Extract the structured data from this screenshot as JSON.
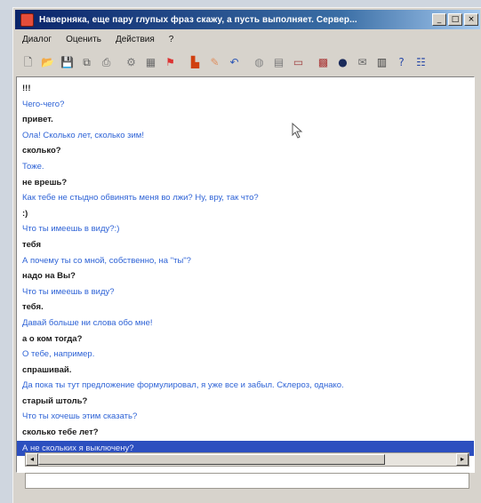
{
  "window": {
    "title": "Наверняка, еще пару глупых фраз скажу, а пусть выполняет. Сервер...",
    "controls": {
      "minimize": "_",
      "maximize": "□",
      "close": "×"
    }
  },
  "menu": [
    "Диалог",
    "Оценить",
    "Действия",
    "?"
  ],
  "toolbar": {
    "icons": [
      {
        "name": "new-doc-icon",
        "glyph": "🗋",
        "color": "#555555"
      },
      {
        "name": "open-folder-icon",
        "glyph": "📂",
        "color": "#c79a2a"
      },
      {
        "name": "save-icon",
        "glyph": "💾",
        "color": "#2b4f9c"
      },
      {
        "name": "copy-icon",
        "glyph": "⧉",
        "color": "#555555"
      },
      {
        "name": "print-icon",
        "glyph": "⎙",
        "color": "#666666"
      },
      {
        "name": "settings-icon",
        "glyph": "⚙",
        "color": "#777777"
      },
      {
        "name": "image-icon",
        "glyph": "▦",
        "color": "#6a6a6a"
      },
      {
        "name": "tag-icon",
        "glyph": "⚑",
        "color": "#d33"
      },
      {
        "name": "chart-icon",
        "glyph": "▙",
        "color": "#d04010"
      },
      {
        "name": "brush-icon",
        "glyph": "✎",
        "color": "#e09060"
      },
      {
        "name": "undo-icon",
        "glyph": "↶",
        "color": "#2d57b5"
      },
      {
        "name": "globe-icon",
        "glyph": "◍",
        "color": "#888888"
      },
      {
        "name": "book-icon",
        "glyph": "▤",
        "color": "#777777"
      },
      {
        "name": "screen-icon",
        "glyph": "▭",
        "color": "#a04040"
      },
      {
        "name": "grid-icon",
        "glyph": "▩",
        "color": "#a83232"
      },
      {
        "name": "record-icon",
        "glyph": "●",
        "color": "#1a2a5a"
      },
      {
        "name": "mail-icon",
        "glyph": "✉",
        "color": "#666666"
      },
      {
        "name": "filmstrip-icon",
        "glyph": "▥",
        "color": "#3a3a3a"
      },
      {
        "name": "question-icon",
        "glyph": "?",
        "color": "#2a4aa8"
      },
      {
        "name": "list-icon",
        "glyph": "☷",
        "color": "#2a4aa8"
      }
    ]
  },
  "chat": {
    "messages": [
      {
        "speaker": "user",
        "text": "!!!"
      },
      {
        "speaker": "bot",
        "text": "Чего-чего?"
      },
      {
        "speaker": "user",
        "text": "привет."
      },
      {
        "speaker": "bot",
        "text": "Ола! Сколько лет, сколько зим!"
      },
      {
        "speaker": "user",
        "text": "сколько?"
      },
      {
        "speaker": "bot",
        "text": "Тоже."
      },
      {
        "speaker": "user",
        "text": "не врешь?"
      },
      {
        "speaker": "bot",
        "text": "Как тебе не стыдно обвинять меня во лжи? Ну, вру, так что?"
      },
      {
        "speaker": "user",
        "text": ":)"
      },
      {
        "speaker": "bot",
        "text": "Что ты имеешь в виду?:)"
      },
      {
        "speaker": "user",
        "text": "тебя"
      },
      {
        "speaker": "bot",
        "text": "А почему ты со мной, собственно, на \"ты\"?"
      },
      {
        "speaker": "user",
        "text": "надо на Вы?"
      },
      {
        "speaker": "bot",
        "text": "Что ты имеешь в виду?"
      },
      {
        "speaker": "user",
        "text": "тебя."
      },
      {
        "speaker": "bot",
        "text": "Давай больше ни слова обо мне!"
      },
      {
        "speaker": "user",
        "text": "а о ком тогда?"
      },
      {
        "speaker": "bot",
        "text": "О тебе, например."
      },
      {
        "speaker": "user",
        "text": "спрашивай."
      },
      {
        "speaker": "bot",
        "text": "Да пока ты тут предложение формулировал, я уже все и забыл. Склероз, однако."
      },
      {
        "speaker": "user",
        "text": "старый штоль?"
      },
      {
        "speaker": "bot",
        "text": "Что ты хочешь этим сказать?"
      },
      {
        "speaker": "user",
        "text": "сколько тебе лет?"
      },
      {
        "speaker": "selected",
        "text": "А не скольких я выключену?"
      }
    ]
  },
  "scrollbar": {
    "left_arrow": "◂",
    "right_arrow": "▸",
    "position": 0.0,
    "visible_fraction": 0.83
  },
  "input": {
    "value": ""
  },
  "colors": {
    "user_text": "#1a1a1a",
    "bot_text": "#2e63d6",
    "selection": "#2c4fbf"
  }
}
